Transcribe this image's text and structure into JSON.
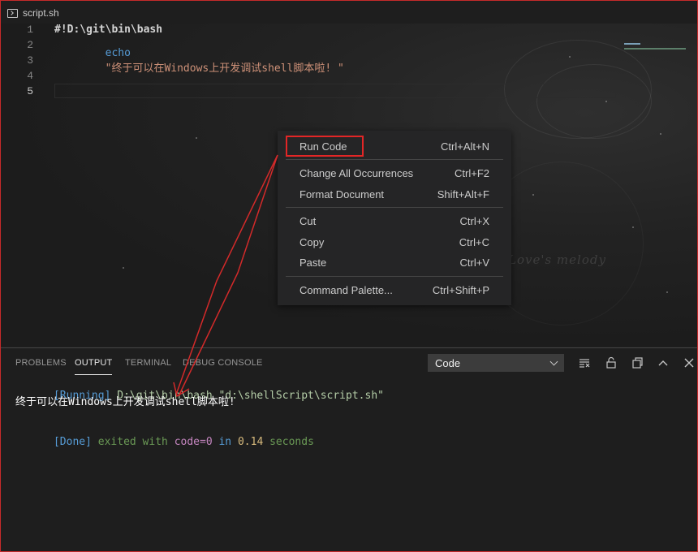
{
  "tab": {
    "title": "script.sh",
    "icon": "terminal-file-icon"
  },
  "editor": {
    "lines": [
      {
        "number": "1",
        "text": "#!D:\\git\\bin\\bash"
      },
      {
        "number": "2",
        "text": ""
      },
      {
        "number": "3",
        "keyword": "echo",
        "string": "\"终于可以在Windows上开发调试shell脚本啦! \""
      },
      {
        "number": "4",
        "text": ""
      },
      {
        "number": "5",
        "text": ""
      }
    ],
    "watermark": "Love's melody"
  },
  "context_menu": {
    "items": [
      {
        "label": "Run Code",
        "shortcut": "Ctrl+Alt+N"
      },
      {
        "label": "Change All Occurrences",
        "shortcut": "Ctrl+F2"
      },
      {
        "label": "Format Document",
        "shortcut": "Shift+Alt+F"
      },
      {
        "label": "Cut",
        "shortcut": "Ctrl+X"
      },
      {
        "label": "Copy",
        "shortcut": "Ctrl+C"
      },
      {
        "label": "Paste",
        "shortcut": "Ctrl+V"
      },
      {
        "label": "Command Palette...",
        "shortcut": "Ctrl+Shift+P"
      }
    ]
  },
  "panel": {
    "tabs": [
      "PROBLEMS",
      "OUTPUT",
      "TERMINAL",
      "DEBUG CONSOLE"
    ],
    "active_tab": "OUTPUT",
    "output_channel": "Code",
    "output": {
      "running_tag": "[Running]",
      "command": "D:\\git\\bin\\bash \"d:\\shellScript\\script.sh\"",
      "result": "终于可以在Windows上开发调试shell脚本啦!",
      "done_tag": "[Done]",
      "exited_with": "exited with",
      "code_label": "code=0",
      "in_word": "in",
      "time": "0.14",
      "seconds": "seconds"
    }
  },
  "colors": {
    "highlight": "#e32626",
    "keyword": "#569cd6",
    "string": "#ce9178",
    "running": "#569cd6",
    "command": "#b5cea8",
    "exited": "#6a9955",
    "code_eq": "#c586c0",
    "number": "#b5cea8"
  }
}
